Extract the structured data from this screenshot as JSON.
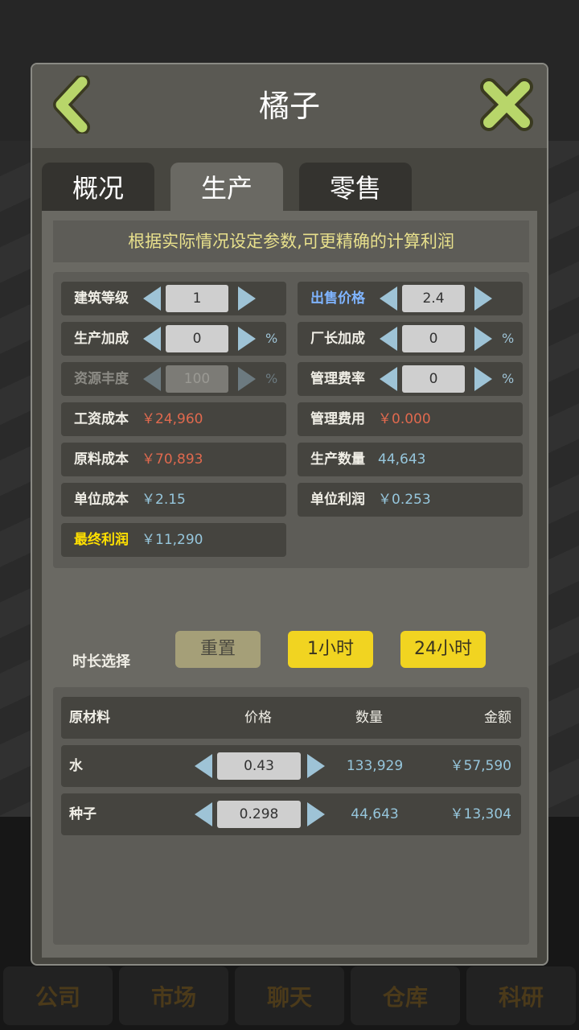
{
  "background": {
    "bottom_tabs": [
      "公司",
      "市场",
      "聊天",
      "仓库",
      "科研"
    ]
  },
  "modal": {
    "title": "橘子",
    "tabs": [
      {
        "label": "概况",
        "active": false
      },
      {
        "label": "生产",
        "active": true
      },
      {
        "label": "零售",
        "active": false
      }
    ],
    "note": "根据实际情况设定参数,可更精确的计算利润",
    "params": {
      "building_level": {
        "label": "建筑等级",
        "value": "1"
      },
      "sale_price": {
        "label": "出售价格",
        "value": "2.4"
      },
      "production_bonus": {
        "label": "生产加成",
        "value": "0",
        "unit": "%"
      },
      "manager_bonus": {
        "label": "厂长加成",
        "value": "0",
        "unit": "%"
      },
      "resource_richness": {
        "label": "资源丰度",
        "value": "100",
        "unit": "%"
      },
      "admin_fee_rate": {
        "label": "管理费率",
        "value": "0",
        "unit": "%"
      },
      "wage_cost": {
        "label": "工资成本",
        "value": "￥24,960"
      },
      "admin_fee": {
        "label": "管理费用",
        "value": "￥0.000"
      },
      "material_cost": {
        "label": "原料成本",
        "value": "￥70,893"
      },
      "production_qty": {
        "label": "生产数量",
        "value": "44,643"
      },
      "unit_cost": {
        "label": "单位成本",
        "value": "￥2.15"
      },
      "unit_profit": {
        "label": "单位利润",
        "value": "￥0.253"
      },
      "final_profit": {
        "label": "最终利润",
        "value": "￥11,290"
      }
    },
    "duration": {
      "label": "时长选择",
      "reset": "重置",
      "one_hour": "1小时",
      "day": "24小时"
    },
    "materials": {
      "headers": {
        "name": "原材料",
        "price": "价格",
        "qty": "数量",
        "amount": "金额"
      },
      "rows": [
        {
          "name": "水",
          "price": "0.43",
          "qty": "133,929",
          "amount": "￥57,590"
        },
        {
          "name": "种子",
          "price": "0.298",
          "qty": "44,643",
          "amount": "￥13,304"
        }
      ]
    }
  },
  "colors": {
    "accent_yellow": "#f1d421",
    "value_red": "#e0694e",
    "value_blue": "#96c6dc",
    "note_text": "#e8e08c",
    "icon_green": "#b8d66a"
  }
}
